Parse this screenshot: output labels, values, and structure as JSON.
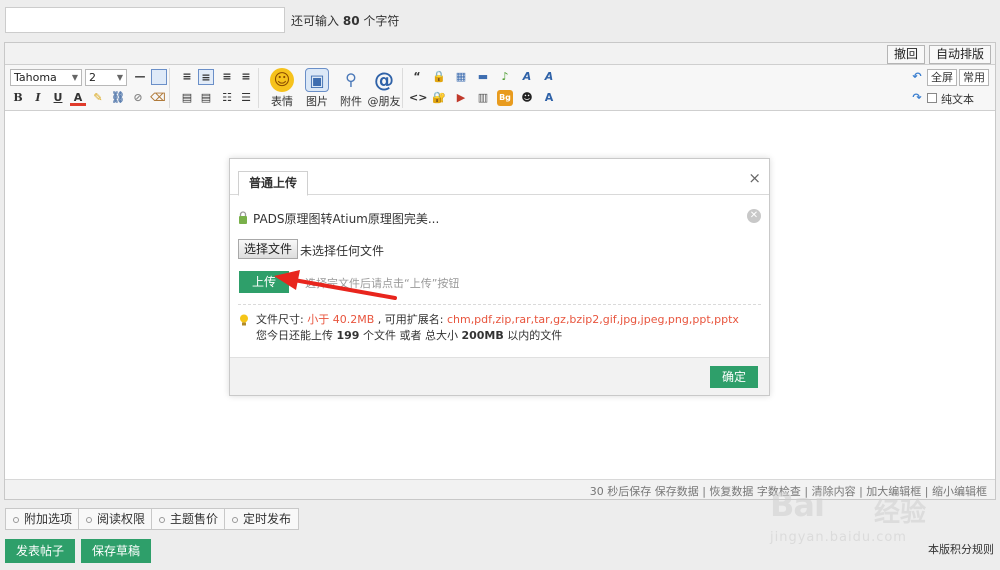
{
  "subject": {
    "value": "",
    "hint_prefix": "还可输入",
    "hint_count": "80",
    "hint_suffix": "个字符"
  },
  "editor_top": {
    "undo": "撤回",
    "auto_format": "自动排版"
  },
  "toolbar": {
    "font_name": "Tahoma",
    "font_size": "2",
    "bold": "B",
    "italic": "I",
    "underline": "U",
    "font_color": "A",
    "emoji_label": "表情",
    "image_label": "图片",
    "attach_label": "附件",
    "at_label": "@朋友",
    "quote": "“",
    "code": "<>",
    "fullscreen": "全屏",
    "common": "常用",
    "plain_text": "纯文本"
  },
  "status_bar": {
    "text": "30 秒后保存 保存数据 | 恢复数据    字数检查 | 清除内容 | 加大编辑框 | 缩小编辑框"
  },
  "dialog": {
    "tab": "普通上传",
    "close": "×",
    "file_name": "PADS原理图转Atium原理图完美...",
    "choose_button": "选择文件",
    "choose_status": "未选择任何文件",
    "upload_button": "上传",
    "upload_hint": "选择完文件后请点击“上传”按钮",
    "size_label": "文件尺寸:",
    "size_value": "小于 40.2MB",
    "ext_label": ", 可用扩展名:",
    "ext_value": "chm,pdf,zip,rar,tar,gz,bzip2,gif,jpg,jpeg,png,ppt,pptx",
    "quota_prefix": "您今日还能上传",
    "quota_count": "199",
    "quota_mid": "个文件 或者 总大小",
    "quota_size": "200MB",
    "quota_suffix": "以内的文件",
    "ok_button": "确定"
  },
  "options": [
    "附加选项",
    "阅读权限",
    "主题售价",
    "定时发布"
  ],
  "actions": {
    "submit": "发表帖子",
    "save_draft": "保存草稿",
    "rules": "本版积分规则"
  },
  "watermark": {
    "brand": "Bai",
    "brand_cn": "经验",
    "url": "jingyan.baidu.com"
  },
  "colors": {
    "accent_green": "#2e9f6a",
    "warning_red": "#e8553e"
  }
}
